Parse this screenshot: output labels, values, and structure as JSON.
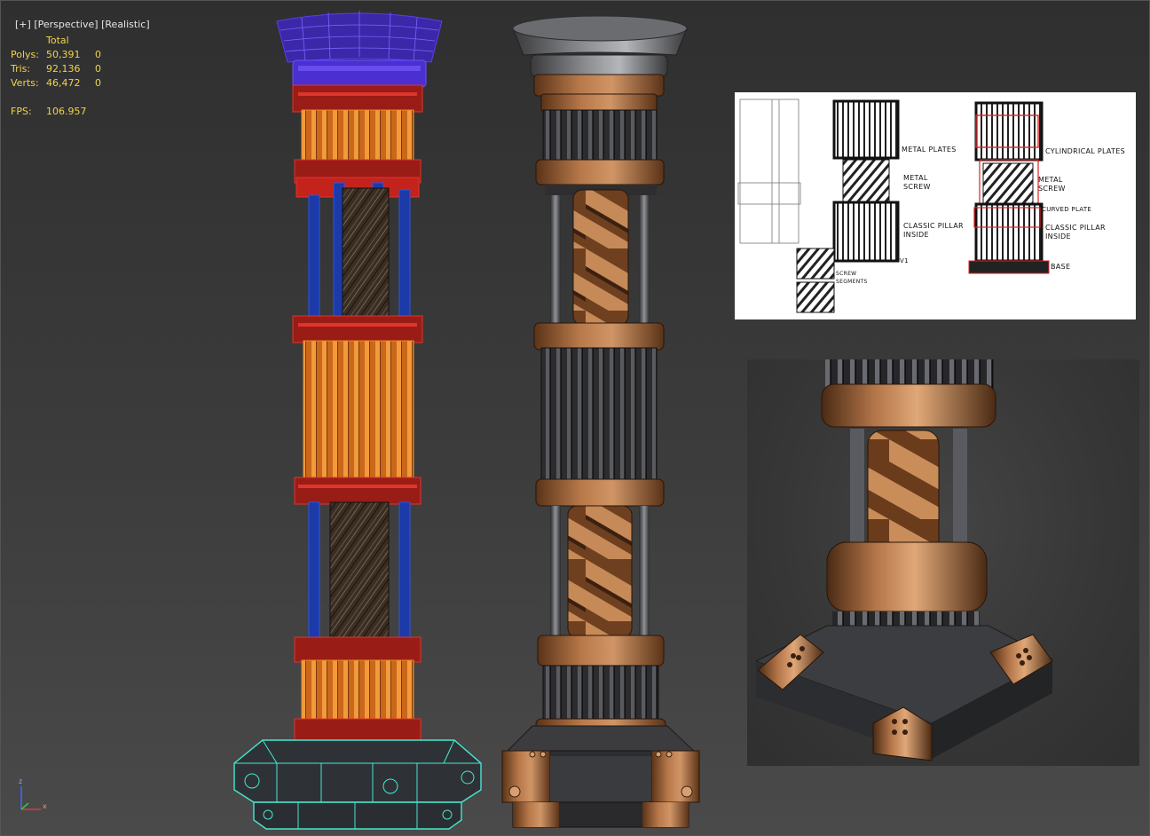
{
  "viewport": {
    "label_parts": [
      "[+]",
      "[Perspective]",
      "[Realistic]"
    ]
  },
  "stats": {
    "header": "Total",
    "rows": [
      {
        "label": "Polys:",
        "value": "50,391",
        "selected": "0"
      },
      {
        "label": "Tris:",
        "value": "92,136",
        "selected": "0"
      },
      {
        "label": "Verts:",
        "value": "46,472",
        "selected": "0"
      }
    ],
    "fps_label": "FPS:",
    "fps_value": "106.957"
  },
  "reference_sheet": {
    "notes": [
      "METAL PLATES",
      "METAL SCREW",
      "CLASSIC PILLAR INSIDE",
      "SCREW SEGMENTS",
      "V1",
      "CYLINDRICAL PLATES",
      "METAL SCREW",
      "CURVED PLATE",
      "CLASSIC PILLAR INSIDE",
      "BASE"
    ]
  },
  "gizmo": {
    "z": "z",
    "x": "x"
  },
  "colors": {
    "wire_purple": "#4b2fd0",
    "wire_red": "#c4231c",
    "wire_orange": "#d9731c",
    "wire_blue": "#1c3aa8",
    "wire_cyan": "#47e7d0",
    "copper": "#a0653a",
    "stats_yellow": "#f1d34b"
  }
}
